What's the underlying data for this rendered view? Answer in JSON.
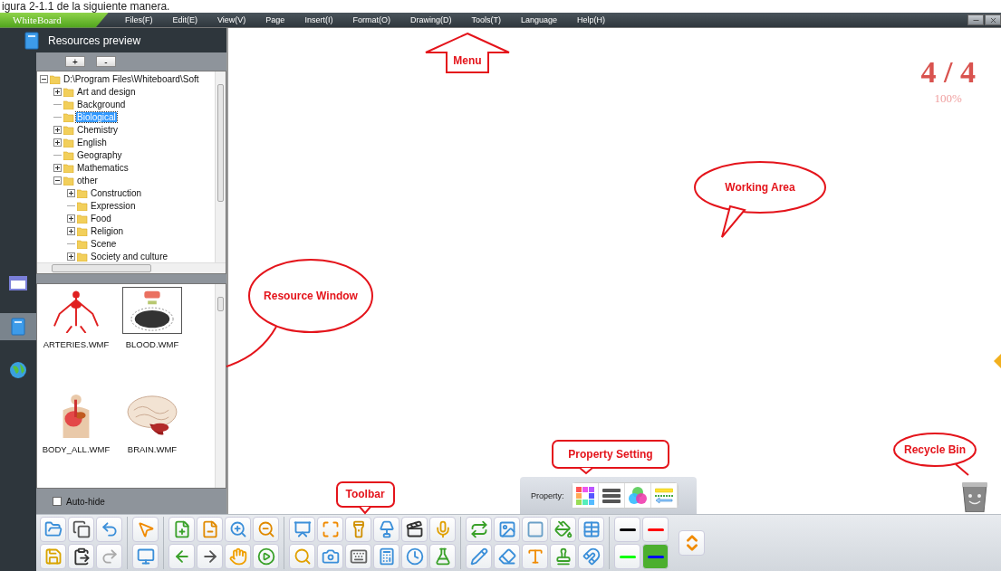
{
  "caption": "igura 2-1.1 de la siguiente manera.",
  "app": {
    "logo": "WhiteBoard"
  },
  "menu": [
    "Files(F)",
    "Edit(E)",
    "View(V)",
    "Page",
    "Insert(I)",
    "Format(O)",
    "Drawing(D)",
    "Tools(T)",
    "Language",
    "Help(H)"
  ],
  "resources": {
    "title": "Resources preview",
    "buttons": [
      "+",
      "-"
    ],
    "tree": {
      "label": "D:\\Program Files\\Whiteboard\\Soft",
      "kind": "expanded",
      "selected": false,
      "children": [
        {
          "label": "Art and design",
          "kind": "collapsed",
          "selected": false
        },
        {
          "label": "Background",
          "kind": "leaf",
          "selected": false
        },
        {
          "label": "Biological",
          "kind": "leaf",
          "selected": true
        },
        {
          "label": "Chemistry",
          "kind": "collapsed",
          "selected": false
        },
        {
          "label": "English",
          "kind": "collapsed",
          "selected": false
        },
        {
          "label": "Geography",
          "kind": "leaf",
          "selected": false
        },
        {
          "label": "Mathematics",
          "kind": "collapsed",
          "selected": false
        },
        {
          "label": "other",
          "kind": "expanded",
          "selected": false,
          "children": [
            {
              "label": "Construction",
              "kind": "collapsed",
              "selected": false
            },
            {
              "label": "Expression",
              "kind": "leaf",
              "selected": false
            },
            {
              "label": "Food",
              "kind": "collapsed",
              "selected": false
            },
            {
              "label": "Religion",
              "kind": "collapsed",
              "selected": false
            },
            {
              "label": "Scene",
              "kind": "leaf",
              "selected": false
            },
            {
              "label": "Society and culture",
              "kind": "collapsed",
              "selected": false
            }
          ]
        }
      ]
    },
    "thumbnails": [
      {
        "label": "ARTERIES.WMF",
        "kind": "picture",
        "selected": false
      },
      {
        "label": "BLOOD.WMF",
        "kind": "picture",
        "selected": true
      },
      {
        "label": "BODY_ALL.WMF",
        "kind": "picture",
        "selected": false
      },
      {
        "label": "BRAIN.WMF",
        "kind": "picture",
        "selected": false
      }
    ],
    "auto_hide": {
      "label": "Auto-hide",
      "checked": false
    }
  },
  "rail": [
    {
      "selected": false
    },
    {
      "selected": true
    },
    {
      "selected": false
    }
  ],
  "canvas": {
    "page": "4 / 4",
    "zoom": "100%"
  },
  "callouts": [
    {
      "text": "Menu",
      "kind": "arrow"
    },
    {
      "text": "Working Area",
      "kind": "ellipse"
    },
    {
      "text": "Resource Window",
      "kind": "ellipse"
    },
    {
      "text": "Toolbar",
      "kind": "rect"
    },
    {
      "text": "Property Setting",
      "kind": "rect"
    },
    {
      "text": "Recycle Bin",
      "kind": "ellipse"
    }
  ],
  "property_bar": {
    "label": "Property:"
  },
  "colors": [
    {
      "color": "#000000",
      "selected": false
    },
    {
      "color": "#ff0000",
      "selected": false
    },
    {
      "color": "#00ff00",
      "selected": false
    },
    {
      "color": "#0000ff",
      "selected": true
    }
  ]
}
